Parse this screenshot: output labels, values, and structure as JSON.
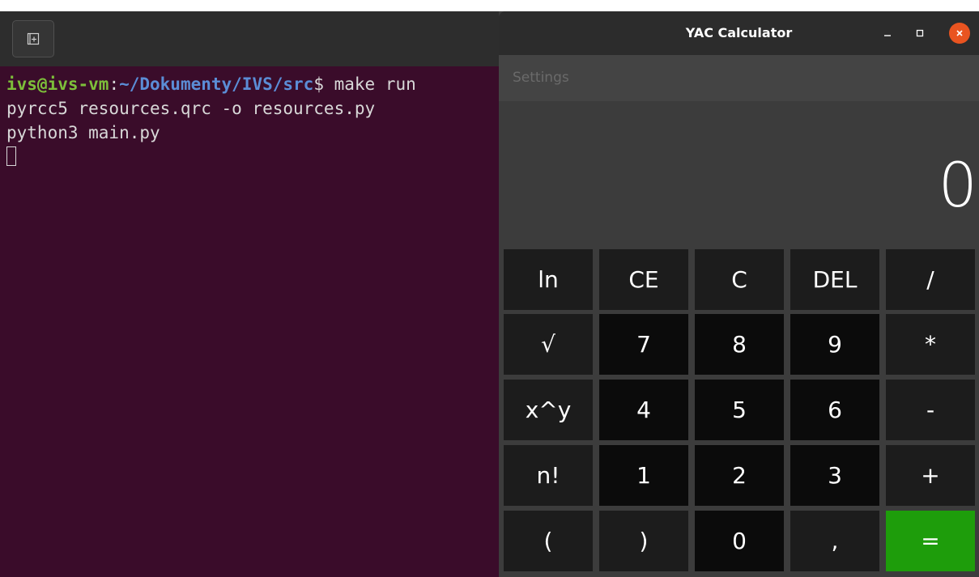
{
  "terminal": {
    "prompt_user": "ivs@ivs-vm",
    "prompt_colon": ":",
    "prompt_path": "~/Dokumenty/IVS/src",
    "prompt_dollar": "$ ",
    "command": "make run",
    "output_line_1": "pyrcc5 resources.qrc -o resources.py",
    "output_line_2": "python3 main.py",
    "new_tab_icon": "new-tab-icon"
  },
  "calculator": {
    "window_title": "YAC Calculator",
    "menu": {
      "settings_label": "Settings"
    },
    "display_value": "0",
    "keys": {
      "ln": "ln",
      "ce": "CE",
      "c": "C",
      "del": "DEL",
      "divide": "/",
      "sqrt": "√",
      "seven": "7",
      "eight": "8",
      "nine": "9",
      "multiply": "*",
      "power": "x^y",
      "four": "4",
      "five": "5",
      "six": "6",
      "minus": "-",
      "factorial": "n!",
      "one": "1",
      "two": "2",
      "three": "3",
      "plus": "+",
      "lparen": "(",
      "rparen": ")",
      "zero": "0",
      "comma": ",",
      "equals": "="
    },
    "window_controls": {
      "minimize_icon": "minimize-icon",
      "maximize_icon": "maximize-icon",
      "close_icon": "close-icon"
    },
    "colors": {
      "equals_key": "#1e9d0b",
      "close_button": "#e95420"
    }
  }
}
